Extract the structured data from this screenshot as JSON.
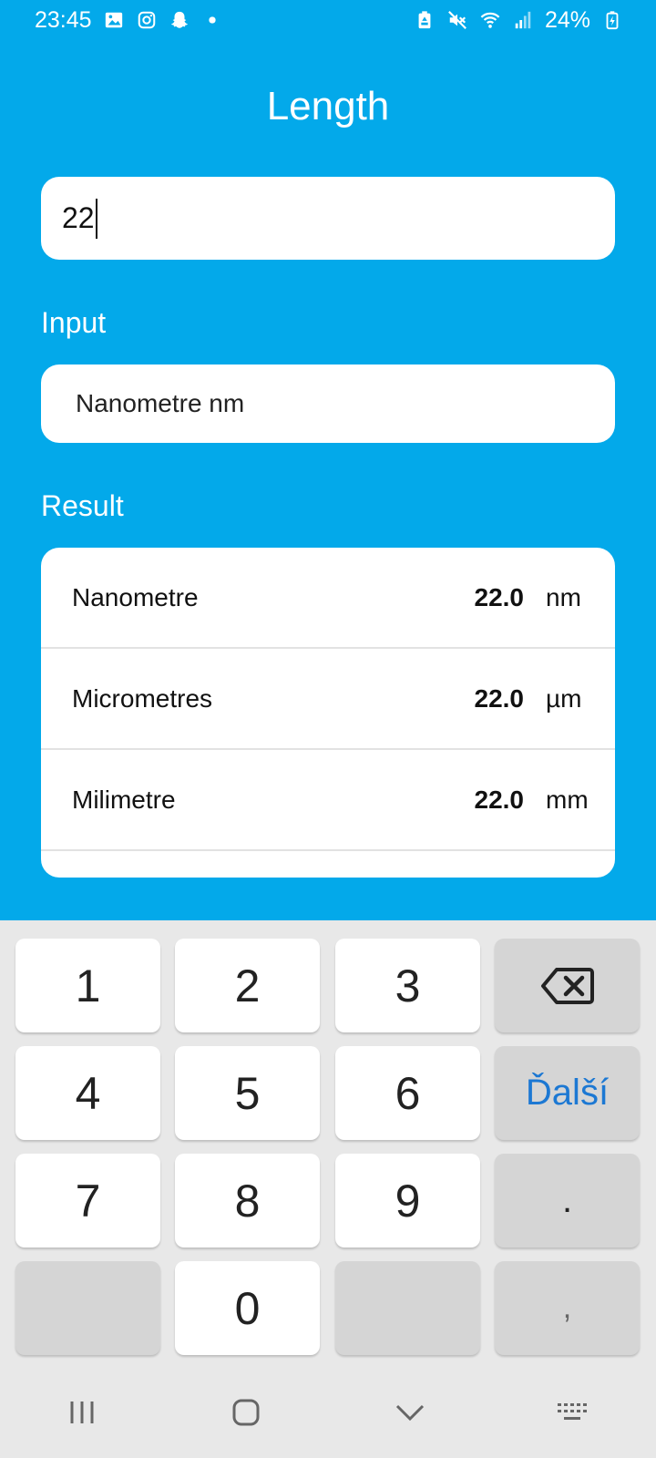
{
  "status": {
    "time": "23:45",
    "battery": "24%",
    "icons": [
      "gallery-icon",
      "instagram-icon",
      "snapchat-icon",
      "dot-icon",
      "battery-saver-icon",
      "mute-icon",
      "wifi-icon",
      "signal-icon",
      "battery-charging-icon"
    ]
  },
  "app": {
    "title": "Length",
    "input_value": "22",
    "input_label": "Input",
    "selected_unit": "Nanometre nm",
    "result_label": "Result"
  },
  "results": [
    {
      "name": "Nanometre",
      "value": "22.0",
      "unit": "nm"
    },
    {
      "name": "Micrometres",
      "value": "22.0",
      "unit": "µm"
    },
    {
      "name": "Milimetre",
      "value": "22.0",
      "unit": "mm"
    }
  ],
  "keyboard": {
    "keys": [
      "1",
      "2",
      "3",
      "4",
      "5",
      "6",
      "7",
      "8",
      "9",
      "0"
    ],
    "next_label": "Ďalší",
    "dot": ".",
    "comma": ","
  },
  "colors": {
    "background": "#03a9ea",
    "accent": "#1c78d3"
  }
}
